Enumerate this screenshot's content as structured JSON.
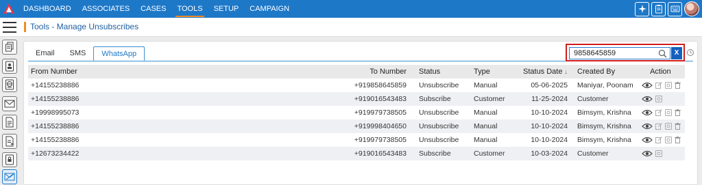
{
  "nav": {
    "items": [
      {
        "label": "DASHBOARD",
        "active": false
      },
      {
        "label": "ASSOCIATES",
        "active": false
      },
      {
        "label": "CASES",
        "active": false
      },
      {
        "label": "TOOLS",
        "active": true
      },
      {
        "label": "SETUP",
        "active": false
      },
      {
        "label": "CAMPAIGN",
        "active": false
      }
    ],
    "right_icons": [
      "sparkle-icon",
      "clipboard-icon",
      "keyboard-icon"
    ]
  },
  "page": {
    "title": "Tools - Manage Unsubscribes"
  },
  "rail_icons": [
    "copy-doc-icon",
    "contact-card-icon",
    "globe-doc-icon",
    "envelope-icon",
    "document-icon",
    "document-arrow-icon",
    "lock-doc-icon",
    "mail-unsubscribe-icon"
  ],
  "tabs": [
    {
      "label": "Email",
      "active": false
    },
    {
      "label": "SMS",
      "active": false
    },
    {
      "label": "WhatsApp",
      "active": true
    }
  ],
  "search": {
    "value": "9858645859",
    "clear_label": "X"
  },
  "table": {
    "headers": {
      "from": "From Number",
      "to": "To Number",
      "status": "Status",
      "type": "Type",
      "date": "Status Date",
      "date_sort": "↓",
      "created": "Created By",
      "action": "Action"
    },
    "rows": [
      {
        "from": "+14155238886",
        "to": "+919858645859",
        "status": "Unsubscribe",
        "type": "Manual",
        "date": "05-06-2025",
        "created": "Maniyar, Poonam",
        "actions": [
          "view",
          "edit",
          "copy",
          "delete"
        ]
      },
      {
        "from": "+14155238886",
        "to": "+919016543483",
        "status": "Subscribe",
        "type": "Customer",
        "date": "11-25-2024",
        "created": "Customer",
        "actions": [
          "view",
          "copy"
        ]
      },
      {
        "from": "+19998995073",
        "to": "+919979738505",
        "status": "Unsubscribe",
        "type": "Manual",
        "date": "10-10-2024",
        "created": "Bimsym, Krishna",
        "actions": [
          "view",
          "edit",
          "copy",
          "delete"
        ]
      },
      {
        "from": "+14155238886",
        "to": "+919998404650",
        "status": "Unsubscribe",
        "type": "Manual",
        "date": "10-10-2024",
        "created": "Bimsym, Krishna",
        "actions": [
          "view",
          "edit",
          "copy",
          "delete"
        ]
      },
      {
        "from": "+14155238886",
        "to": "+919979738505",
        "status": "Unsubscribe",
        "type": "Manual",
        "date": "10-10-2024",
        "created": "Bimsym, Krishna",
        "actions": [
          "view",
          "edit",
          "copy",
          "delete"
        ]
      },
      {
        "from": "+12673234422",
        "to": "+919016543483",
        "status": "Subscribe",
        "type": "Customer",
        "date": "10-03-2024",
        "created": "Customer",
        "actions": [
          "view",
          "copy"
        ]
      }
    ]
  },
  "colors": {
    "nav_bg": "#1e78c8",
    "accent": "#f08a24",
    "title": "#1e5fa0",
    "highlight_border": "#d01c1c",
    "clear_button": "#1560bd"
  }
}
